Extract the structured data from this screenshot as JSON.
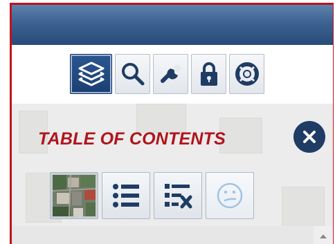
{
  "toolbar": {
    "items": [
      {
        "id": "layers",
        "icon": "layers-icon",
        "active": true
      },
      {
        "id": "search",
        "icon": "search-icon",
        "active": false
      },
      {
        "id": "tools",
        "icon": "wrench-icon",
        "active": false
      },
      {
        "id": "secure",
        "icon": "lock-icon",
        "active": false
      },
      {
        "id": "help",
        "icon": "lifebuoy-icon",
        "active": false
      }
    ]
  },
  "toc": {
    "title": "TABLE OF CONTENTS",
    "close_icon": "close-icon",
    "buttons": [
      {
        "id": "basemap",
        "icon": "aerial-thumbnail-icon"
      },
      {
        "id": "legend",
        "icon": "bullet-list-icon"
      },
      {
        "id": "clear-layers",
        "icon": "list-remove-icon"
      },
      {
        "id": "feedback",
        "icon": "smiley-icon",
        "disabled": true
      }
    ]
  },
  "scrollbar": {
    "up_icon": "triangle-up-icon"
  },
  "colors": {
    "title_red": "#b0141c",
    "frame_red": "#c0121c",
    "header_blue": "#284b78",
    "active_button": "#1b3f72",
    "icon_dark": "#1f3c64"
  }
}
